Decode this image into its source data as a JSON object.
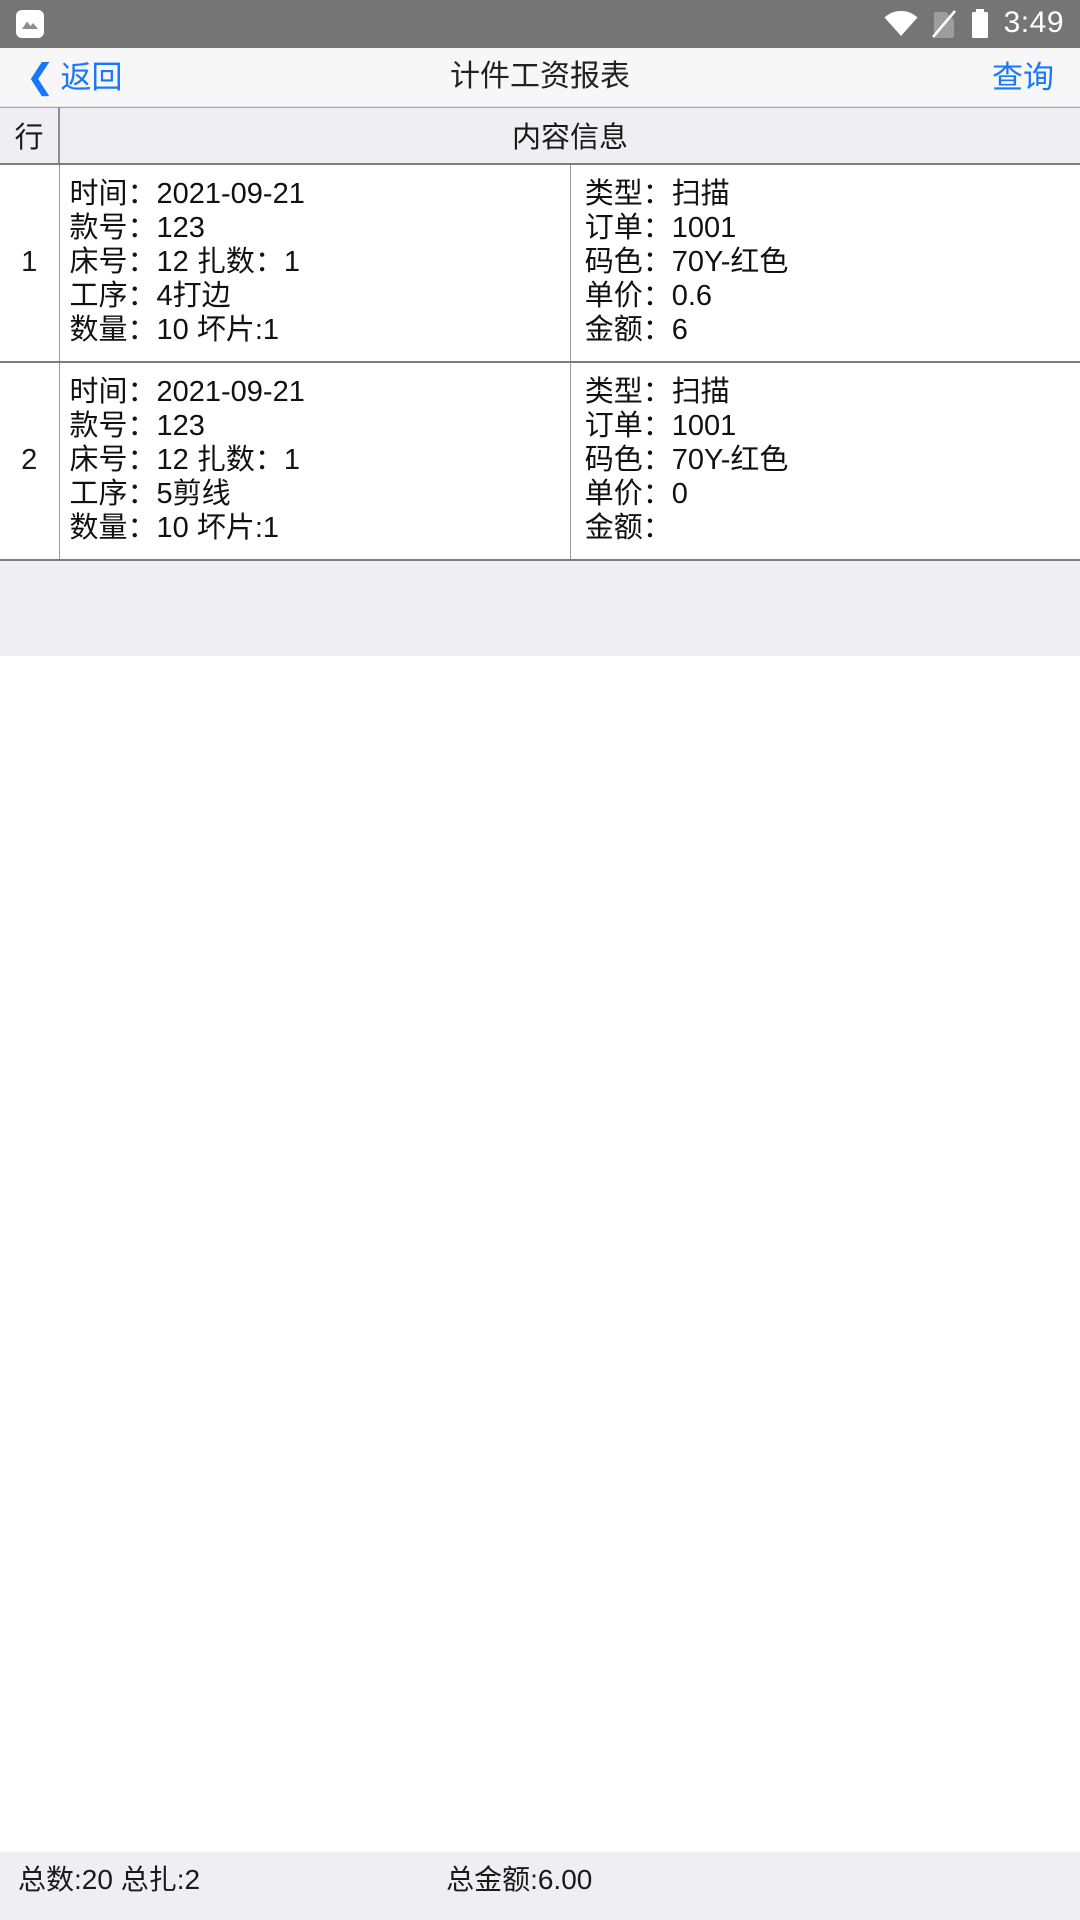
{
  "statusbar": {
    "app_icon": "image-icon",
    "wifi_icon": "wifi-icon",
    "sim_icon": "no-sim-icon",
    "battery_icon": "battery-icon",
    "time": "3:49"
  },
  "navbar": {
    "back_icon": "chevron-left-icon",
    "back_label": "返回",
    "title": "计件工资报表",
    "action_label": "查询",
    "accent_color": "#1677ff"
  },
  "table": {
    "headers": {
      "index": "行",
      "content": "内容信息"
    },
    "rows": [
      {
        "index": "1",
        "left": [
          "时间：2021-09-21",
          "款号：123",
          "床号：12 扎数：1",
          "工序：4打边",
          "数量：10 坏片:1"
        ],
        "right": [
          "类型：扫描",
          "订单：1001",
          "码色：70Y-红色",
          "单价：0.6",
          "金额：6"
        ]
      },
      {
        "index": "2",
        "left": [
          "时间：2021-09-21",
          "款号：123",
          "床号：12 扎数：1",
          "工序：5剪线",
          "数量：10 坏片:1"
        ],
        "right": [
          "类型：扫描",
          "订单：1001",
          "码色：70Y-红色",
          "单价：0",
          "金额："
        ]
      }
    ]
  },
  "summary": {
    "totals": "总数:20 总扎:2",
    "amount": "总金额:6.00"
  }
}
